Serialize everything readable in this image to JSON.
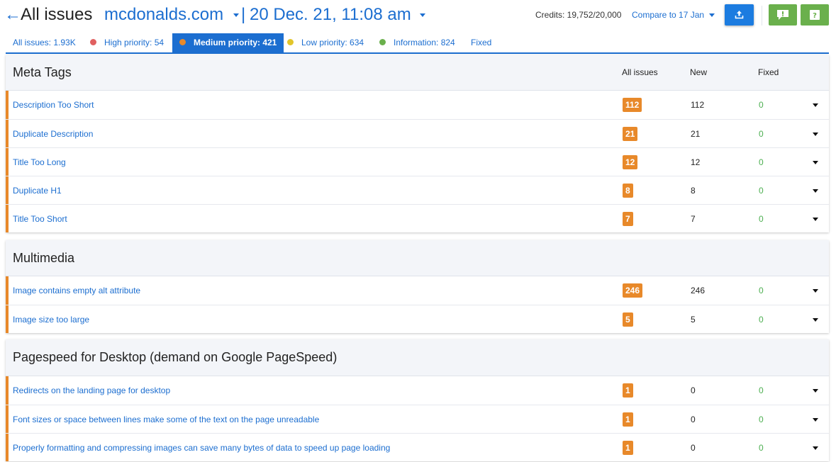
{
  "header": {
    "back_icon": "←",
    "title": "All issues",
    "domain": "mcdonalds.com",
    "separator": "|",
    "date": "20 Dec. 21, 11:08 am",
    "credits": "Credits: 19,752/20,000",
    "compare_label": "Compare to  17 Jan",
    "icons": {
      "export": "upload-icon",
      "feedback": "exclamation-icon",
      "help": "question-icon"
    },
    "colors": {
      "accent": "#1c6ed0",
      "green_button": "#6ab04c",
      "export_button": "#1c7ce0"
    }
  },
  "tabs": [
    {
      "label": "All issues: 1.93K",
      "dot": null
    },
    {
      "label": "High priority: 54",
      "dot": "#e06060"
    },
    {
      "label": "Medium priority: 421",
      "dot": "#e8892a",
      "active": true
    },
    {
      "label": "Low priority: 634",
      "dot": "#e2c52a"
    },
    {
      "label": "Information: 824",
      "dot": "#6ab04c"
    },
    {
      "label": "Fixed",
      "dot": null
    }
  ],
  "columns": {
    "all_issues": "All issues",
    "new": "New",
    "fixed": "Fixed"
  },
  "sections": [
    {
      "title": "Meta Tags",
      "show_columns": true,
      "rows": [
        {
          "label": "Description Too Short",
          "all": "112",
          "new": "112",
          "fixed": "0"
        },
        {
          "label": "Duplicate Description",
          "all": "21",
          "new": "21",
          "fixed": "0"
        },
        {
          "label": "Title Too Long",
          "all": "12",
          "new": "12",
          "fixed": "0"
        },
        {
          "label": "Duplicate H1",
          "all": "8",
          "new": "8",
          "fixed": "0"
        },
        {
          "label": "Title Too Short",
          "all": "7",
          "new": "7",
          "fixed": "0"
        }
      ]
    },
    {
      "title": "Multimedia",
      "show_columns": false,
      "rows": [
        {
          "label": "Image contains empty alt attribute",
          "all": "246",
          "new": "246",
          "fixed": "0"
        },
        {
          "label": "Image size too large",
          "all": "5",
          "new": "5",
          "fixed": "0"
        }
      ]
    },
    {
      "title": "Pagespeed for Desktop (demand on Google PageSpeed)",
      "show_columns": false,
      "rows": [
        {
          "label": "Redirects on the landing page for desktop",
          "all": "1",
          "new": "0",
          "fixed": "0"
        },
        {
          "label": "Font sizes or space between lines make some of the text on the page unreadable",
          "all": "1",
          "new": "0",
          "fixed": "0"
        },
        {
          "label": "Properly formatting and compressing images can save many bytes of data to speed up page loading",
          "all": "1",
          "new": "0",
          "fixed": "0"
        }
      ]
    }
  ],
  "colors": {
    "priority_stripe": "#e8892a",
    "fixed_text": "#4caf50",
    "section_header_bg": "#f3f5f9"
  }
}
